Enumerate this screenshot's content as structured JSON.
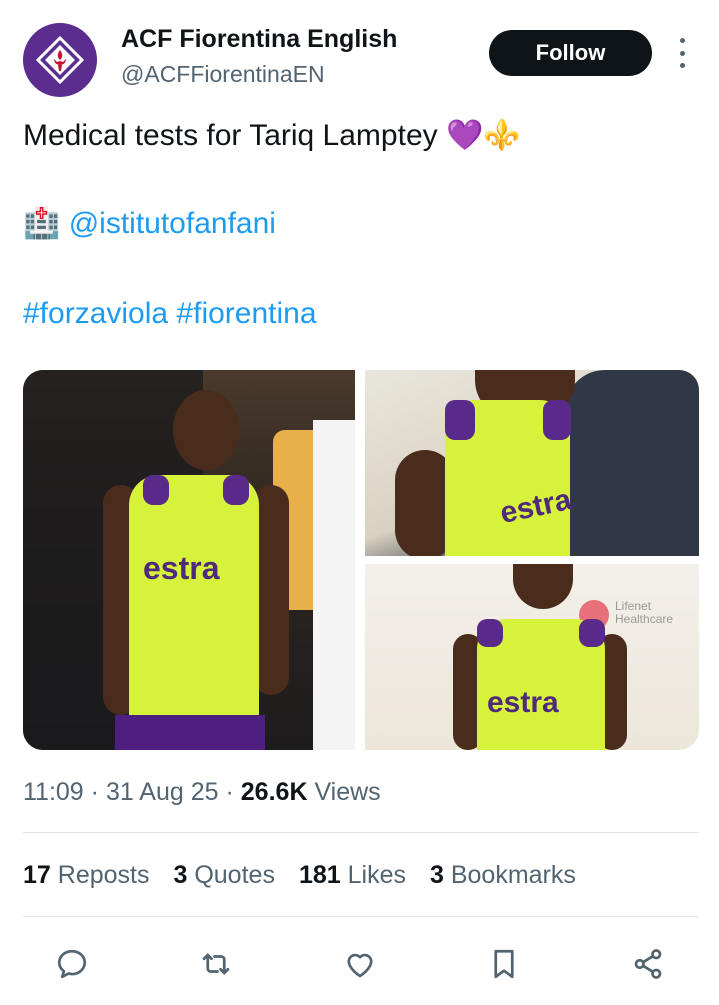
{
  "account": {
    "name": "ACF Fiorentina English",
    "handle": "@ACFFiorentinaEN",
    "follow_label": "Follow"
  },
  "tweet": {
    "line1": "Medical tests for Tariq Lamptey ",
    "emoji_heart": "💜",
    "emoji_lily": "⚜️",
    "emoji_hospital": "🏥",
    "mention": "@istitutofanfani",
    "hashtag1": "#forzaviola",
    "hashtag2": "#fiorentina"
  },
  "images": {
    "brand_text": "estra",
    "sign_text": "Lifenet Healthcare"
  },
  "meta": {
    "time": "11:09",
    "sep1": " · ",
    "date": "31 Aug 25",
    "sep2": " · ",
    "views_count": "26.6K",
    "views_label": " Views"
  },
  "stats": {
    "reposts_count": "17",
    "reposts_label": " Reposts",
    "quotes_count": "3",
    "quotes_label": " Quotes",
    "likes_count": "181",
    "likes_label": " Likes",
    "bookmarks_count": "3",
    "bookmarks_label": " Bookmarks"
  },
  "colors": {
    "accent": "#1d9bf0",
    "text": "#0f1419",
    "secondary": "#536471",
    "brand_purple": "#5b2d8e",
    "jersey": "#d7f23a"
  }
}
